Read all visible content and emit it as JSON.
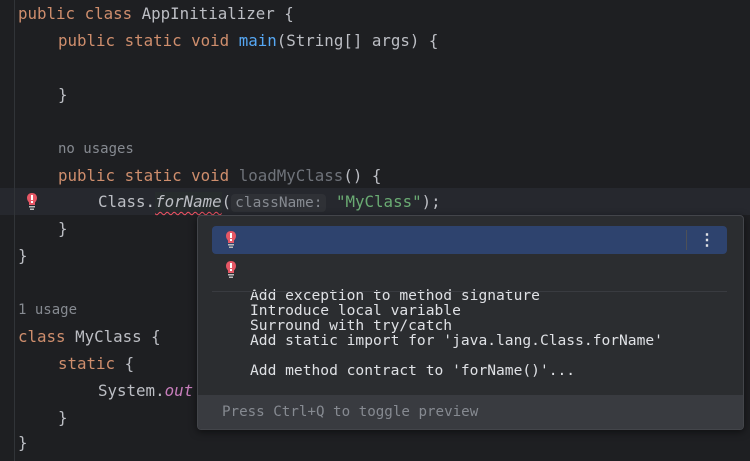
{
  "code": {
    "l1": {
      "kw": "public class ",
      "name": "AppInitializer {"
    },
    "l2": {
      "kw": "public static void ",
      "fn": "main",
      "rest": "(String[] args) {"
    },
    "l4": "}",
    "l6": "no usages",
    "l7": {
      "kw": "public static void ",
      "fn": "loadMyClass",
      "rest": "() {"
    },
    "l8": {
      "pre": "Class.",
      "method": "forName",
      "paren": "(",
      "hint": "className:",
      "str": "\"MyClass\"",
      "end": ");"
    },
    "l9": "}",
    "l10": "}",
    "l12": "1 usage",
    "l13": {
      "kw": "class ",
      "name": "MyClass {"
    },
    "l14": {
      "kw": "static",
      "rest": " {"
    },
    "l15": {
      "pre": "System.",
      "field": "out"
    },
    "l16": "}",
    "l17": "}"
  },
  "popup": {
    "items": [
      {
        "label": "Add exception to method signature",
        "icon": "error-bulb-icon"
      },
      {
        "label": "Surround with try/catch",
        "icon": "error-bulb-icon"
      },
      {
        "label": "Introduce local variable"
      },
      {
        "label": "Add static import for 'java.lang.Class.forName'"
      },
      {
        "label": "Add method contract to 'forName()'..."
      }
    ],
    "more": "⋮",
    "footer": "Press Ctrl+Q to toggle preview"
  },
  "colors": {
    "error": "#e55765",
    "selection": "#2e436e",
    "keyword": "#cf8e6d",
    "function": "#56a8f5",
    "string": "#6aab73"
  }
}
